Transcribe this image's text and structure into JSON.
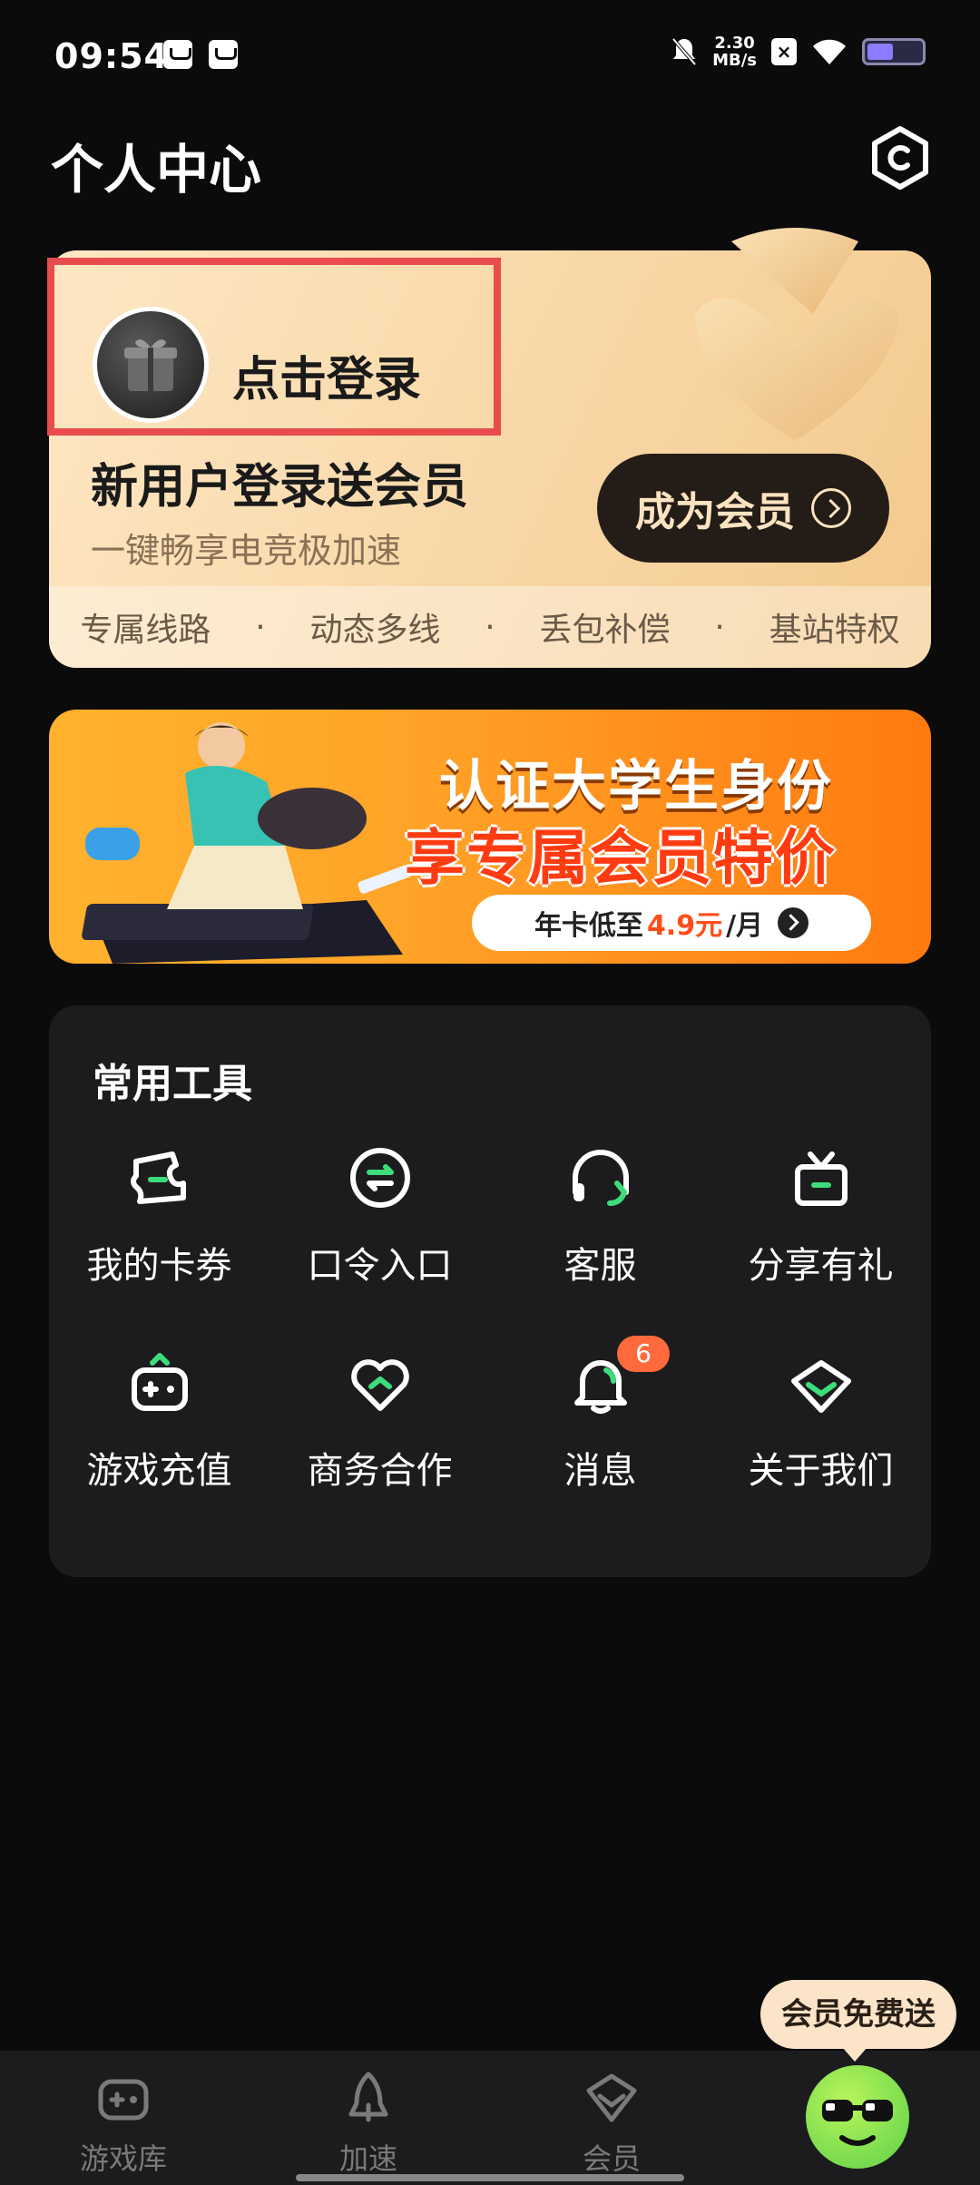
{
  "status_bar": {
    "time": "09:54",
    "net_speed_value": "2.30",
    "net_speed_unit": "MB/s"
  },
  "header": {
    "title": "个人中心"
  },
  "member_card": {
    "login_label": "点击登录",
    "promo_title": "新用户登录送会员",
    "promo_subtitle": "一键畅享电竞极加速",
    "become_member_label": "成为会员",
    "benefits": [
      "专属线路",
      "动态多线",
      "丢包补偿",
      "基站特权"
    ],
    "separator": "·",
    "colors": {
      "card_start": "#fde7c4",
      "card_end": "#f3c98c",
      "button_bg": "#241c17",
      "button_text": "#fbe3c0",
      "highlight_box": "#e84c4c"
    }
  },
  "student_banner": {
    "line1": "认证大学生身份",
    "line2": "享专属会员特价",
    "pill_prefix": "年卡低至",
    "pill_price": "4.9元",
    "pill_suffix": "/月"
  },
  "tools": {
    "title": "常用工具",
    "items": [
      {
        "label": "我的卡券",
        "icon": "coupon-icon"
      },
      {
        "label": "口令入口",
        "icon": "exchange-icon"
      },
      {
        "label": "客服",
        "icon": "headset-icon"
      },
      {
        "label": "分享有礼",
        "icon": "gift-icon"
      },
      {
        "label": "游戏充值",
        "icon": "gamepad-icon"
      },
      {
        "label": "商务合作",
        "icon": "heart-icon"
      },
      {
        "label": "消息",
        "icon": "bell-icon",
        "badge": "6"
      },
      {
        "label": "关于我们",
        "icon": "logo-icon"
      }
    ],
    "accent_color": "#3ddc7a"
  },
  "bottom_nav": {
    "items": [
      {
        "label": "游戏库",
        "icon": "game-library-icon"
      },
      {
        "label": "加速",
        "icon": "rocket-icon"
      },
      {
        "label": "会员",
        "icon": "member-icon"
      }
    ],
    "free_member_bubble": "会员免费送"
  }
}
